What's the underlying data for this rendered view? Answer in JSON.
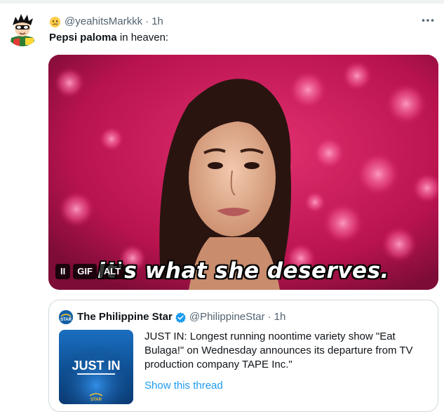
{
  "tweet": {
    "author_handle": "@yeahitsMarkkk",
    "separator": "·",
    "time": "1h",
    "text_bold": "Pepsi paloma",
    "text_rest": " in heaven:",
    "avatar_icon": "cartoon-avatar-icon",
    "emoji_icon": "tearful-face-icon",
    "more_icon": "more-horizontal-icon"
  },
  "media": {
    "caption": "It's what she deserves.",
    "pause_label": "II",
    "gif_label": "GIF",
    "alt_label": "ALT",
    "background_color": "#c81a5c"
  },
  "quote": {
    "name": "The Philippine Star",
    "handle": "@PhilippineStar",
    "separator": "·",
    "time": "1h",
    "text": "JUST IN: Longest running noontime variety show \"Eat Bulaga!\" on Wednesday announces its departure from TV production company TAPE Inc.\"",
    "link": "Show this thread",
    "thumb_headline": "JUST IN",
    "thumb_brand": "STAR",
    "avatar_label": "STAR",
    "verified_icon": "verified-badge-icon",
    "accent_color": "#1d9bf0",
    "brand_color": "#1160a6"
  }
}
